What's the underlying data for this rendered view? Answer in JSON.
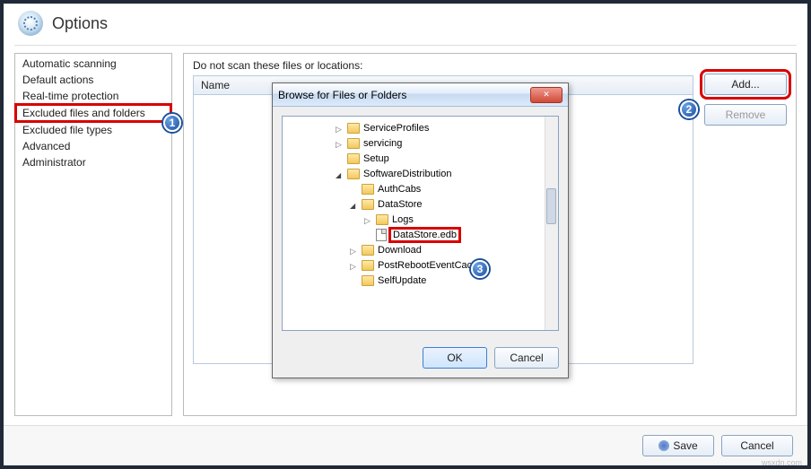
{
  "header": {
    "title": "Options"
  },
  "sidebar": {
    "items": [
      "Automatic scanning",
      "Default actions",
      "Real-time protection",
      "Excluded files and folders",
      "Excluded file types",
      "Advanced",
      "Administrator"
    ],
    "selectedIndex": 3
  },
  "content": {
    "sectionLabel": "Do not scan these files or locations:",
    "listHeader": "Name",
    "addButton": "Add...",
    "removeButton": "Remove"
  },
  "dialog": {
    "title": "Browse for Files or Folders",
    "tree": [
      {
        "indent": 3,
        "expander": "right",
        "type": "folder",
        "label": "ServiceProfiles"
      },
      {
        "indent": 3,
        "expander": "right",
        "type": "folder",
        "label": "servicing"
      },
      {
        "indent": 3,
        "expander": "none",
        "type": "folder",
        "label": "Setup"
      },
      {
        "indent": 3,
        "expander": "down",
        "type": "folder",
        "label": "SoftwareDistribution"
      },
      {
        "indent": 4,
        "expander": "none",
        "type": "folder",
        "label": "AuthCabs"
      },
      {
        "indent": 4,
        "expander": "down",
        "type": "folder",
        "label": "DataStore"
      },
      {
        "indent": 5,
        "expander": "right",
        "type": "folder",
        "label": "Logs"
      },
      {
        "indent": 5,
        "expander": "none",
        "type": "file",
        "label": "DataStore.edb",
        "selected": true
      },
      {
        "indent": 4,
        "expander": "right",
        "type": "folder",
        "label": "Download"
      },
      {
        "indent": 4,
        "expander": "right",
        "type": "folder",
        "label": "PostRebootEventCache"
      },
      {
        "indent": 4,
        "expander": "none",
        "type": "folder",
        "label": "SelfUpdate"
      }
    ],
    "okButton": "OK",
    "cancelButton": "Cancel"
  },
  "footer": {
    "save": "Save",
    "cancel": "Cancel"
  },
  "note": "wsxdn.com",
  "callouts": {
    "a": "1",
    "b": "2",
    "c": "3"
  }
}
